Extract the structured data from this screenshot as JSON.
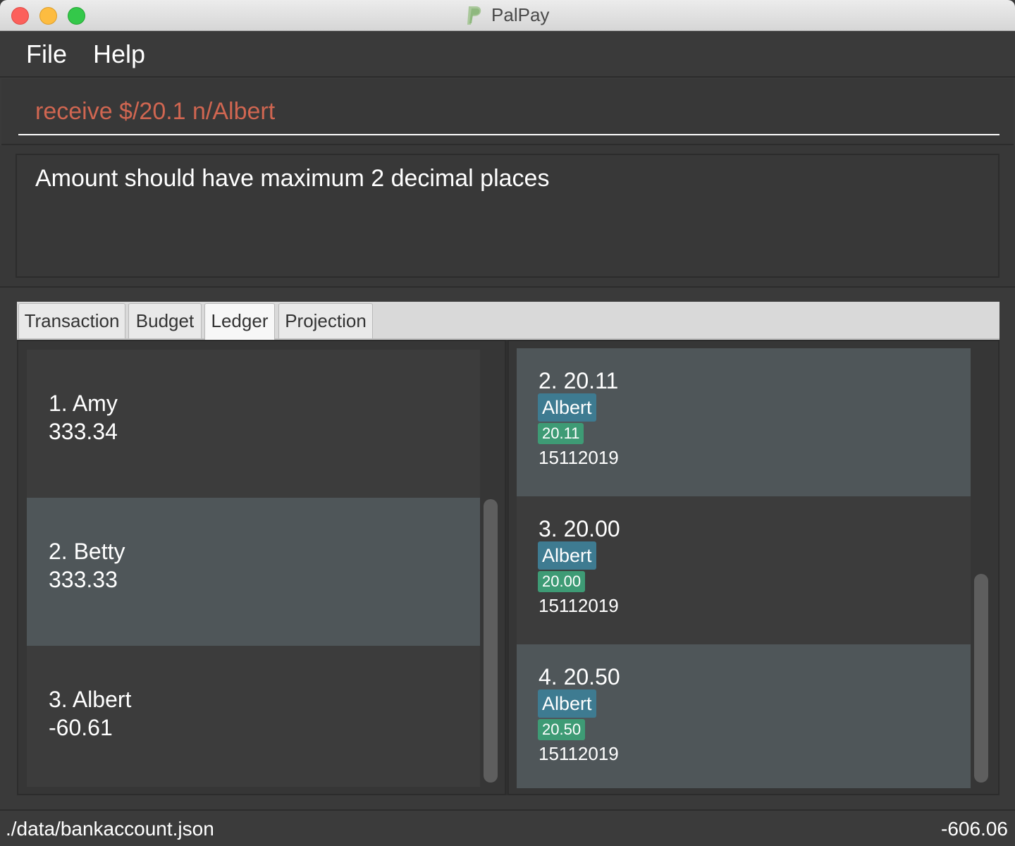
{
  "window": {
    "title": "PalPay"
  },
  "menu": {
    "file": "File",
    "help": "Help"
  },
  "command": {
    "value": "receive $/20.1 n/Albert"
  },
  "result": {
    "message": "Amount should have maximum 2 decimal places"
  },
  "tabs": [
    {
      "label": "Transaction",
      "active": false
    },
    {
      "label": "Budget",
      "active": false
    },
    {
      "label": "Ledger",
      "active": true
    },
    {
      "label": "Projection",
      "active": false
    }
  ],
  "people": [
    {
      "name": "1.  Amy",
      "amount": "333.34"
    },
    {
      "name": "2.  Betty",
      "amount": "333.33"
    },
    {
      "name": "3.  Albert",
      "amount": "-60.61"
    }
  ],
  "transactions": [
    {
      "heading": "2.  20.11",
      "person": "Albert",
      "amount": "20.11",
      "date": "15112019"
    },
    {
      "heading": "3.  20.00",
      "person": "Albert",
      "amount": "20.00",
      "date": "15112019"
    },
    {
      "heading": "4.  20.50",
      "person": "Albert",
      "amount": "20.50",
      "date": "15112019"
    }
  ],
  "status": {
    "path": "./data/bankaccount.json",
    "balance": "-606.06"
  },
  "colors": {
    "command_text": "#d06651",
    "name_tag": "#3e7b91",
    "amount_tag": "#3e9b75",
    "selected_row": "#4f5659",
    "background": "#3a3a3a"
  }
}
